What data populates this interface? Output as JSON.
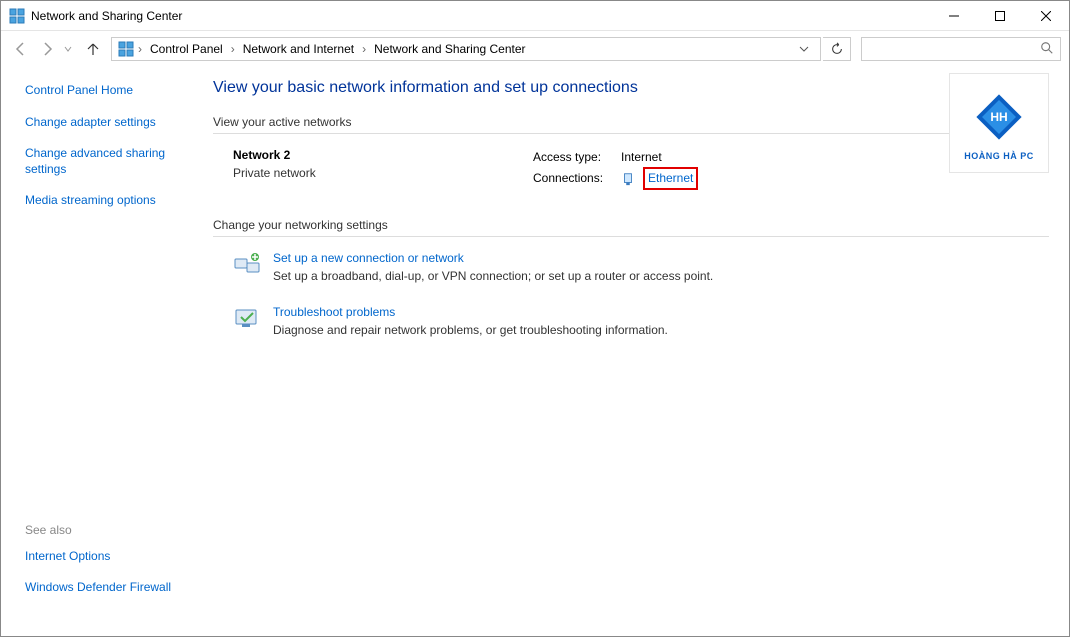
{
  "window": {
    "title": "Network and Sharing Center"
  },
  "breadcrumbs": {
    "b0": "Control Panel",
    "b1": "Network and Internet",
    "b2": "Network and Sharing Center"
  },
  "sidebar": {
    "home": "Control Panel Home",
    "adapter": "Change adapter settings",
    "advanced": "Change advanced sharing settings",
    "media": "Media streaming options"
  },
  "seealso": {
    "label": "See also",
    "internet_options": "Internet Options",
    "firewall": "Windows Defender Firewall"
  },
  "main": {
    "heading": "View your basic network information and set up connections",
    "active_label": "View your active networks",
    "network_name": "Network 2",
    "network_type": "Private network",
    "access_label": "Access type:",
    "access_value": "Internet",
    "connections_label": "Connections:",
    "connections_value": "Ethernet",
    "change_label": "Change your networking settings",
    "setup_link": "Set up a new connection or network",
    "setup_desc": "Set up a broadband, dial-up, or VPN connection; or set up a router or access point.",
    "troubleshoot_link": "Troubleshoot problems",
    "troubleshoot_desc": "Diagnose and repair network problems, or get troubleshooting information."
  },
  "logo": {
    "text": "HOÀNG HÀ PC"
  }
}
